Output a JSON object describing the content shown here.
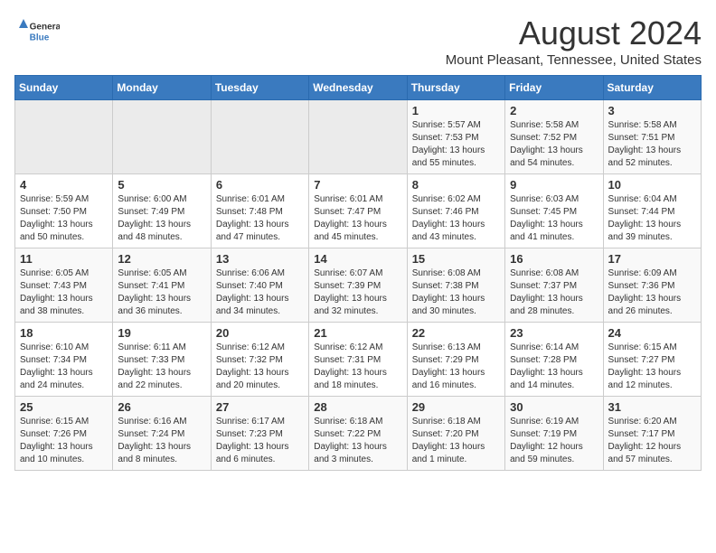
{
  "logo": {
    "text_general": "General",
    "text_blue": "Blue"
  },
  "header": {
    "title": "August 2024",
    "subtitle": "Mount Pleasant, Tennessee, United States"
  },
  "days_of_week": [
    "Sunday",
    "Monday",
    "Tuesday",
    "Wednesday",
    "Thursday",
    "Friday",
    "Saturday"
  ],
  "weeks": [
    [
      {
        "day": "",
        "info": ""
      },
      {
        "day": "",
        "info": ""
      },
      {
        "day": "",
        "info": ""
      },
      {
        "day": "",
        "info": ""
      },
      {
        "day": "1",
        "info": "Sunrise: 5:57 AM\nSunset: 7:53 PM\nDaylight: 13 hours\nand 55 minutes."
      },
      {
        "day": "2",
        "info": "Sunrise: 5:58 AM\nSunset: 7:52 PM\nDaylight: 13 hours\nand 54 minutes."
      },
      {
        "day": "3",
        "info": "Sunrise: 5:58 AM\nSunset: 7:51 PM\nDaylight: 13 hours\nand 52 minutes."
      }
    ],
    [
      {
        "day": "4",
        "info": "Sunrise: 5:59 AM\nSunset: 7:50 PM\nDaylight: 13 hours\nand 50 minutes."
      },
      {
        "day": "5",
        "info": "Sunrise: 6:00 AM\nSunset: 7:49 PM\nDaylight: 13 hours\nand 48 minutes."
      },
      {
        "day": "6",
        "info": "Sunrise: 6:01 AM\nSunset: 7:48 PM\nDaylight: 13 hours\nand 47 minutes."
      },
      {
        "day": "7",
        "info": "Sunrise: 6:01 AM\nSunset: 7:47 PM\nDaylight: 13 hours\nand 45 minutes."
      },
      {
        "day": "8",
        "info": "Sunrise: 6:02 AM\nSunset: 7:46 PM\nDaylight: 13 hours\nand 43 minutes."
      },
      {
        "day": "9",
        "info": "Sunrise: 6:03 AM\nSunset: 7:45 PM\nDaylight: 13 hours\nand 41 minutes."
      },
      {
        "day": "10",
        "info": "Sunrise: 6:04 AM\nSunset: 7:44 PM\nDaylight: 13 hours\nand 39 minutes."
      }
    ],
    [
      {
        "day": "11",
        "info": "Sunrise: 6:05 AM\nSunset: 7:43 PM\nDaylight: 13 hours\nand 38 minutes."
      },
      {
        "day": "12",
        "info": "Sunrise: 6:05 AM\nSunset: 7:41 PM\nDaylight: 13 hours\nand 36 minutes."
      },
      {
        "day": "13",
        "info": "Sunrise: 6:06 AM\nSunset: 7:40 PM\nDaylight: 13 hours\nand 34 minutes."
      },
      {
        "day": "14",
        "info": "Sunrise: 6:07 AM\nSunset: 7:39 PM\nDaylight: 13 hours\nand 32 minutes."
      },
      {
        "day": "15",
        "info": "Sunrise: 6:08 AM\nSunset: 7:38 PM\nDaylight: 13 hours\nand 30 minutes."
      },
      {
        "day": "16",
        "info": "Sunrise: 6:08 AM\nSunset: 7:37 PM\nDaylight: 13 hours\nand 28 minutes."
      },
      {
        "day": "17",
        "info": "Sunrise: 6:09 AM\nSunset: 7:36 PM\nDaylight: 13 hours\nand 26 minutes."
      }
    ],
    [
      {
        "day": "18",
        "info": "Sunrise: 6:10 AM\nSunset: 7:34 PM\nDaylight: 13 hours\nand 24 minutes."
      },
      {
        "day": "19",
        "info": "Sunrise: 6:11 AM\nSunset: 7:33 PM\nDaylight: 13 hours\nand 22 minutes."
      },
      {
        "day": "20",
        "info": "Sunrise: 6:12 AM\nSunset: 7:32 PM\nDaylight: 13 hours\nand 20 minutes."
      },
      {
        "day": "21",
        "info": "Sunrise: 6:12 AM\nSunset: 7:31 PM\nDaylight: 13 hours\nand 18 minutes."
      },
      {
        "day": "22",
        "info": "Sunrise: 6:13 AM\nSunset: 7:29 PM\nDaylight: 13 hours\nand 16 minutes."
      },
      {
        "day": "23",
        "info": "Sunrise: 6:14 AM\nSunset: 7:28 PM\nDaylight: 13 hours\nand 14 minutes."
      },
      {
        "day": "24",
        "info": "Sunrise: 6:15 AM\nSunset: 7:27 PM\nDaylight: 13 hours\nand 12 minutes."
      }
    ],
    [
      {
        "day": "25",
        "info": "Sunrise: 6:15 AM\nSunset: 7:26 PM\nDaylight: 13 hours\nand 10 minutes."
      },
      {
        "day": "26",
        "info": "Sunrise: 6:16 AM\nSunset: 7:24 PM\nDaylight: 13 hours\nand 8 minutes."
      },
      {
        "day": "27",
        "info": "Sunrise: 6:17 AM\nSunset: 7:23 PM\nDaylight: 13 hours\nand 6 minutes."
      },
      {
        "day": "28",
        "info": "Sunrise: 6:18 AM\nSunset: 7:22 PM\nDaylight: 13 hours\nand 3 minutes."
      },
      {
        "day": "29",
        "info": "Sunrise: 6:18 AM\nSunset: 7:20 PM\nDaylight: 13 hours\nand 1 minute."
      },
      {
        "day": "30",
        "info": "Sunrise: 6:19 AM\nSunset: 7:19 PM\nDaylight: 12 hours\nand 59 minutes."
      },
      {
        "day": "31",
        "info": "Sunrise: 6:20 AM\nSunset: 7:17 PM\nDaylight: 12 hours\nand 57 minutes."
      }
    ]
  ]
}
